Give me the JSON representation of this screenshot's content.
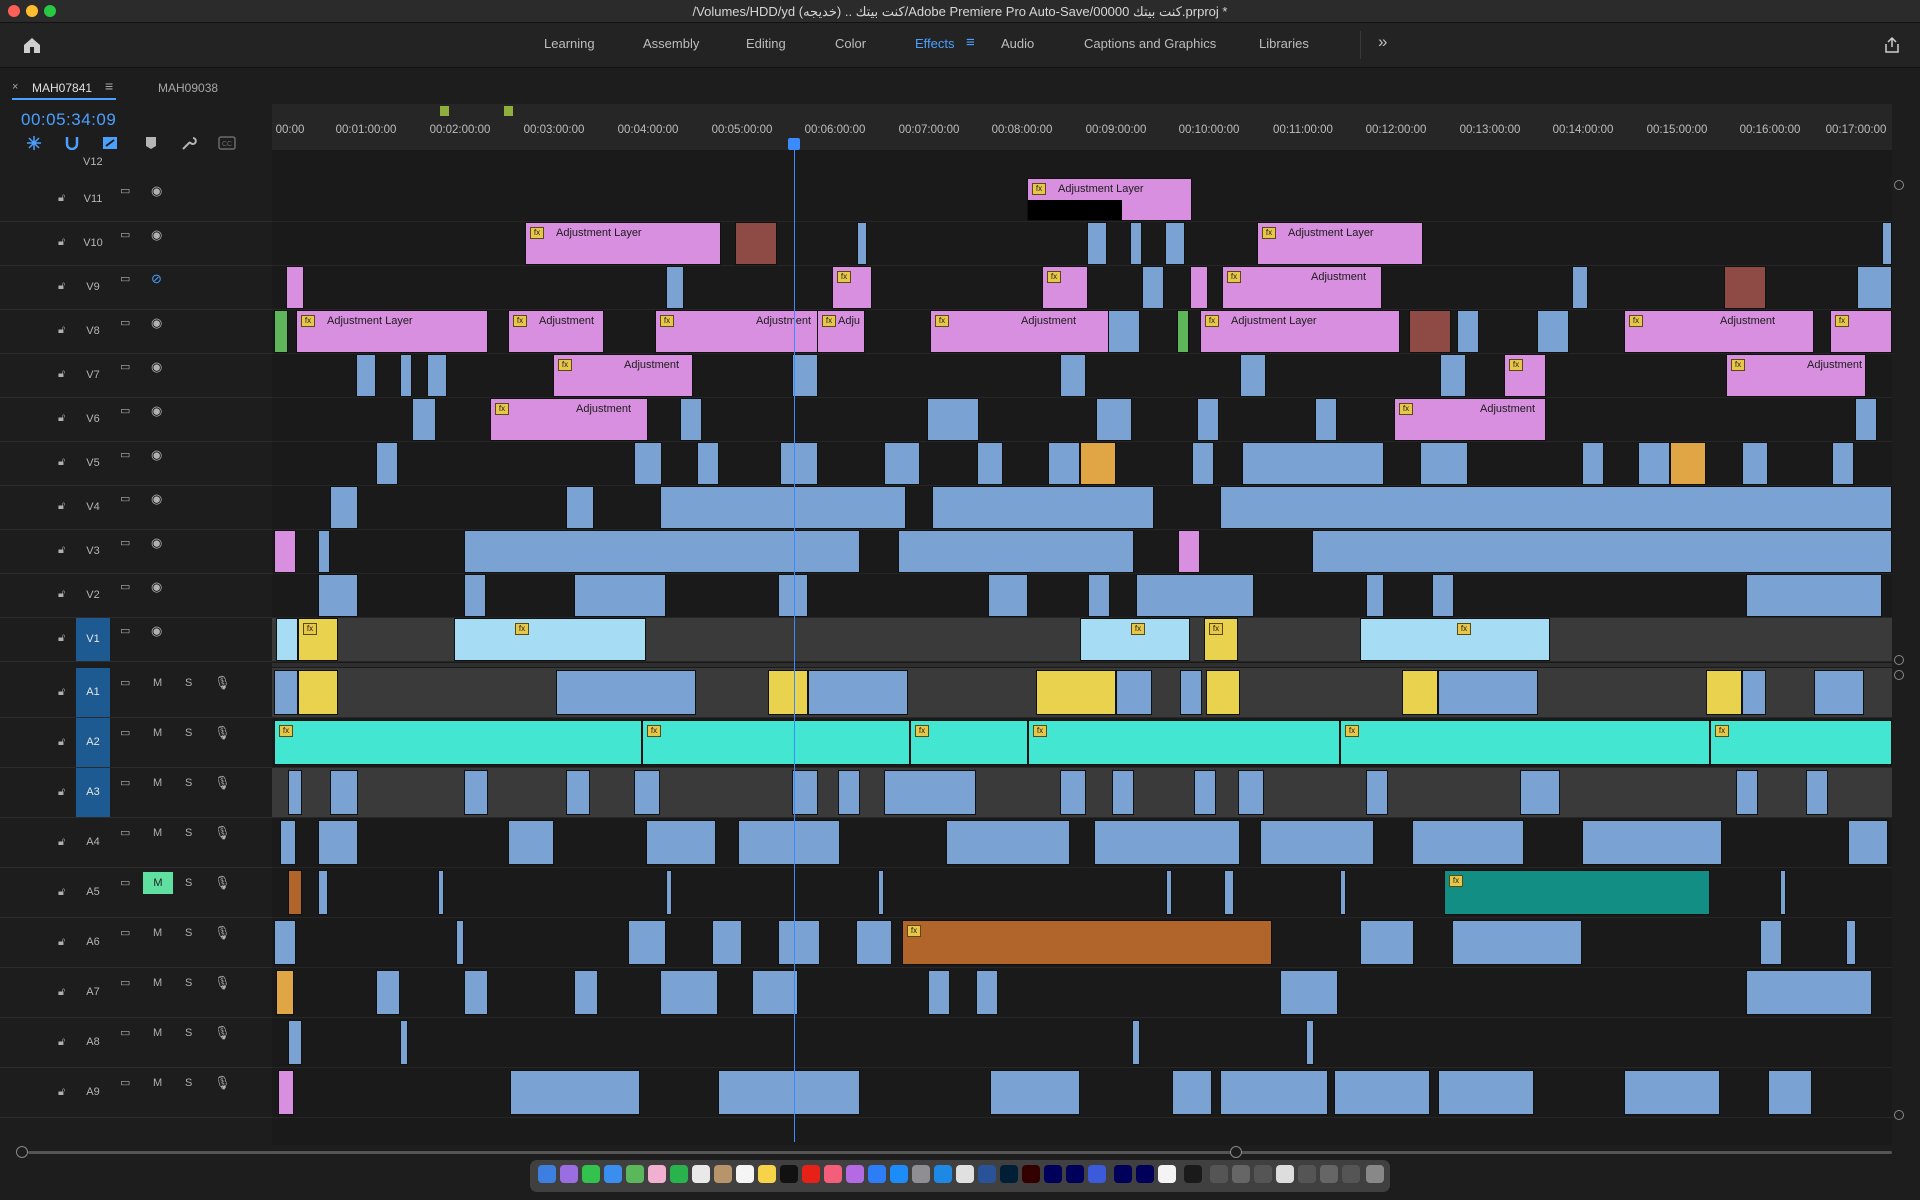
{
  "window": {
    "title": "/Volumes/HDD/yd (خديجه) .. كنت بيتك/Adobe Premiere Pro Auto-Save/00000  كنت بيتك.prproj *"
  },
  "workspace_tabs": [
    {
      "label": "Learning",
      "active": false
    },
    {
      "label": "Assembly",
      "active": false
    },
    {
      "label": "Editing",
      "active": false
    },
    {
      "label": "Color",
      "active": false
    },
    {
      "label": "Effects",
      "active": true
    },
    {
      "label": "Audio",
      "active": false
    },
    {
      "label": "Captions and Graphics",
      "active": false
    },
    {
      "label": "Libraries",
      "active": false
    }
  ],
  "sequence_tabs": [
    {
      "label": "MAH07841",
      "active": true
    },
    {
      "label": "MAH09038",
      "active": false
    }
  ],
  "timecode": "00:05:34:09",
  "ruler_ticks": [
    "00:00",
    "00:01:00:00",
    "00:02:00:00",
    "00:03:00:00",
    "00:04:00:00",
    "00:05:00:00",
    "00:06:00:00",
    "00:07:00:00",
    "00:08:00:00",
    "00:09:00:00",
    "00:10:00:00",
    "00:11:00:00",
    "00:12:00:00",
    "00:13:00:00",
    "00:14:00:00",
    "00:15:00:00",
    "00:16:00:00",
    "00:17:00:00"
  ],
  "top_track_label": "V12",
  "video_tracks": [
    {
      "name": "V11",
      "eye_off": false,
      "targeted": false
    },
    {
      "name": "V10",
      "eye_off": false,
      "targeted": false
    },
    {
      "name": "V9",
      "eye_off": true,
      "targeted": false
    },
    {
      "name": "V8",
      "eye_off": false,
      "targeted": false
    },
    {
      "name": "V7",
      "eye_off": false,
      "targeted": false
    },
    {
      "name": "V6",
      "eye_off": false,
      "targeted": false
    },
    {
      "name": "V5",
      "eye_off": false,
      "targeted": false
    },
    {
      "name": "V4",
      "eye_off": false,
      "targeted": false
    },
    {
      "name": "V3",
      "eye_off": false,
      "targeted": false
    },
    {
      "name": "V2",
      "eye_off": false,
      "targeted": false
    },
    {
      "name": "V1",
      "eye_off": false,
      "targeted": true
    }
  ],
  "audio_tracks": [
    {
      "name": "A1",
      "targeted": true,
      "muted": false
    },
    {
      "name": "A2",
      "targeted": true,
      "muted": false
    },
    {
      "name": "A3",
      "targeted": true,
      "muted": false
    },
    {
      "name": "A4",
      "targeted": false,
      "muted": false
    },
    {
      "name": "A5",
      "targeted": false,
      "muted": true
    },
    {
      "name": "A6",
      "targeted": false,
      "muted": false
    },
    {
      "name": "A7",
      "targeted": false,
      "muted": false
    },
    {
      "name": "A8",
      "targeted": false,
      "muted": false
    },
    {
      "name": "A9",
      "targeted": false,
      "muted": false
    }
  ],
  "mute_label": "M",
  "solo_label": "S",
  "clip_labels": {
    "adjustment_layer": "Adjustment Layer",
    "adjustment": "Adjustment",
    "adju": "Adju"
  },
  "colors": {
    "accent": "#4ba0ff",
    "adjustment_layer": "#d98fe0",
    "video_clip": "#7aa2d2",
    "audio_aqua": "#43e6d0",
    "audio_teal": "#138e85",
    "audio_brown": "#b1652a",
    "highlight_yellow": "#e8d24e"
  }
}
